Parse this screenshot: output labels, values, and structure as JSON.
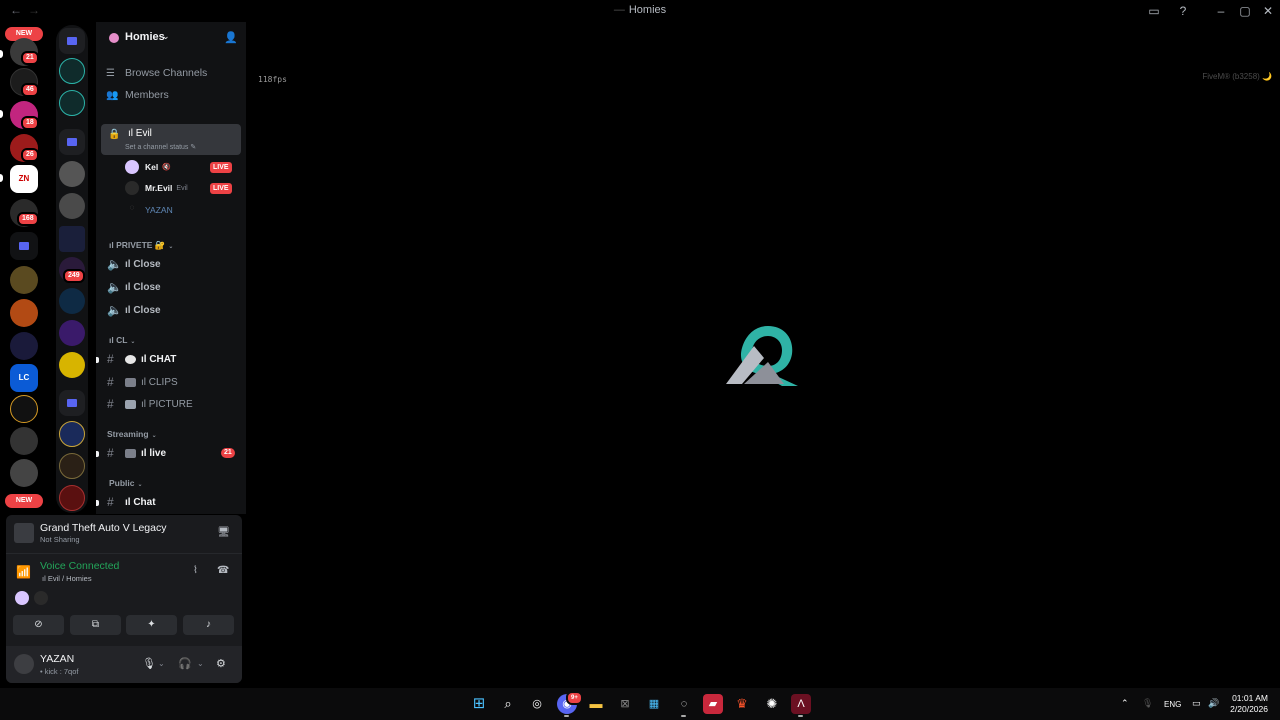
{
  "window": {
    "title": "Homies",
    "back": "←",
    "forward": "→"
  },
  "rail1": {
    "new_top": "NEW",
    "new_bottom": "NEW",
    "badges": [
      "21",
      "46",
      "18",
      "26",
      "168"
    ]
  },
  "rail2": {
    "badges": [
      "249"
    ]
  },
  "guild": {
    "name": "Homies",
    "chevron": "⌄",
    "icon_color": "#e58ec9"
  },
  "nav": {
    "browse_channels": "Browse Channels",
    "members": "Members"
  },
  "voice_channel": {
    "name": "ıl Evil",
    "status": "Set a channel status ✎",
    "users": [
      {
        "name": "Kel",
        "extra": "",
        "live": "LIVE"
      },
      {
        "name": "Mr.Evil",
        "extra": "Evil",
        "live": "LIVE"
      },
      {
        "name": "YAZAN",
        "extra": "",
        "live": ""
      }
    ]
  },
  "categories": {
    "privete": "ıl PRIVETE 🔐",
    "cl": "ıl CL",
    "streaming": "Streaming",
    "public": "Public"
  },
  "channels": {
    "close1": "ıl Close",
    "close2": "ıl Close",
    "close3": "ıl Close",
    "chat": "ıl CHAT",
    "clips": "ıl CLIPS",
    "picture": "ıl PICTURE",
    "live": "ıl live",
    "live_mentions": "21",
    "public_chat": "ıl Chat"
  },
  "activity": {
    "game": "Grand Theft Auto V Legacy",
    "sharing": "Not Sharing"
  },
  "voice_status": {
    "title": "Voice Connected",
    "location": "ıl Evil / Homies"
  },
  "user": {
    "name": "YAZAN",
    "status": "• kick : 7qof"
  },
  "main": {
    "fps": "118fps",
    "build": "FiveM® (b3258) 🌙"
  },
  "taskbar": {
    "discord_badge": "9+",
    "lang": "ENG",
    "time": "01:01 AM",
    "date": "2/20/2026"
  },
  "colors": {
    "accent_green": "#23a55a",
    "danger_red": "#ed4245",
    "blurple": "#5865f2",
    "sidebar_bg": "#111214"
  }
}
